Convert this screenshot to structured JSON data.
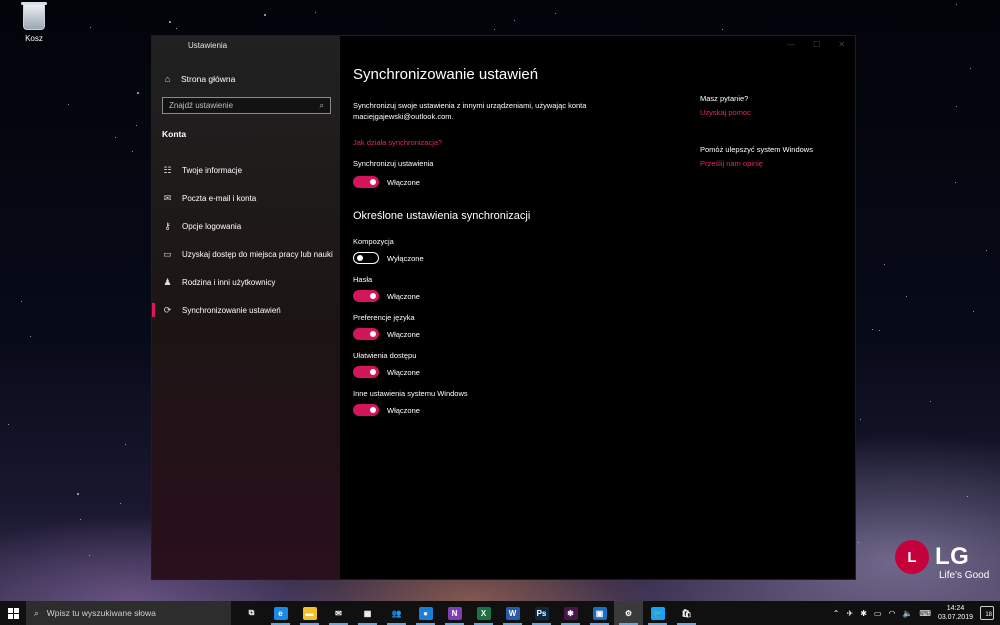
{
  "desktop": {
    "recycle_bin_label": "Kosz",
    "brand": {
      "logo_text": "LG",
      "tagline": "Life's Good"
    }
  },
  "window": {
    "title": "Ustawienia"
  },
  "sidebar": {
    "home_label": "Strona główna",
    "search_placeholder": "Znajdź ustawienie",
    "section_title": "Konta",
    "items": [
      {
        "label": "Twoje informacje",
        "icon": "person-card-icon"
      },
      {
        "label": "Poczta e-mail i konta",
        "icon": "mail-icon"
      },
      {
        "label": "Opcje logowania",
        "icon": "key-icon"
      },
      {
        "label": "Uzyskaj dostęp do miejsca pracy lub nauki",
        "icon": "briefcase-icon"
      },
      {
        "label": "Rodzina i inni użytkownicy",
        "icon": "people-icon"
      },
      {
        "label": "Synchronizowanie ustawień",
        "icon": "sync-icon",
        "active": true
      }
    ]
  },
  "main": {
    "title": "Synchronizowanie ustawień",
    "description": "Synchronizuj swoje ustawienia z innymi urządzeniami, używając konta maciejgajewski@outlook.com.",
    "how_link": "Jak działa synchronizacja?",
    "sync_label": "Synchronizuj ustawienia",
    "sync_state": "Włączone",
    "individual_title": "Określone ustawienia synchronizacji",
    "settings": [
      {
        "label": "Kompozycja",
        "state": "Wyłączone",
        "on": false
      },
      {
        "label": "Hasła",
        "state": "Włączone",
        "on": true
      },
      {
        "label": "Preferencje języka",
        "state": "Włączone",
        "on": true
      },
      {
        "label": "Ułatwienia dostępu",
        "state": "Włączone",
        "on": true
      },
      {
        "label": "Inne ustawienia systemu Windows",
        "state": "Włączone",
        "on": true
      }
    ]
  },
  "aside": {
    "question_title": "Masz pytanie?",
    "help_link": "Uzyskaj pomoc",
    "improve_title": "Pomóż ulepszyć system Windows",
    "feedback_link": "Prześlij nam opinię"
  },
  "taskbar": {
    "search_placeholder": "Wpisz tu wyszukiwane słowa",
    "apps": [
      {
        "name": "task-view",
        "glyph": "⧉",
        "color": "transparent"
      },
      {
        "name": "edge",
        "glyph": "e",
        "color": "#1e88e5"
      },
      {
        "name": "file-explorer",
        "glyph": "▬",
        "color": "#f3c02b"
      },
      {
        "name": "mail",
        "glyph": "✉",
        "color": "transparent"
      },
      {
        "name": "calendar",
        "glyph": "▦",
        "color": "transparent"
      },
      {
        "name": "people",
        "glyph": "👥",
        "color": "transparent"
      },
      {
        "name": "photos-app",
        "glyph": "●",
        "color": "#1c7fd6"
      },
      {
        "name": "onenote",
        "glyph": "N",
        "color": "#7d3fb3"
      },
      {
        "name": "excel",
        "glyph": "X",
        "color": "#1d7044"
      },
      {
        "name": "word",
        "glyph": "W",
        "color": "#2a5ba8"
      },
      {
        "name": "photoshop",
        "glyph": "Ps",
        "color": "#0b2741"
      },
      {
        "name": "slack",
        "glyph": "✱",
        "color": "#4a154b"
      },
      {
        "name": "planner",
        "glyph": "▣",
        "color": "#1c6ec2"
      },
      {
        "name": "settings",
        "glyph": "⚙",
        "color": "transparent",
        "active": true
      },
      {
        "name": "twitter",
        "glyph": "🐦",
        "color": "#1da1f2"
      },
      {
        "name": "store",
        "glyph": "🛍",
        "color": "transparent"
      }
    ],
    "time": "14:24",
    "date": "03.07.2019",
    "notification_count": "18"
  }
}
